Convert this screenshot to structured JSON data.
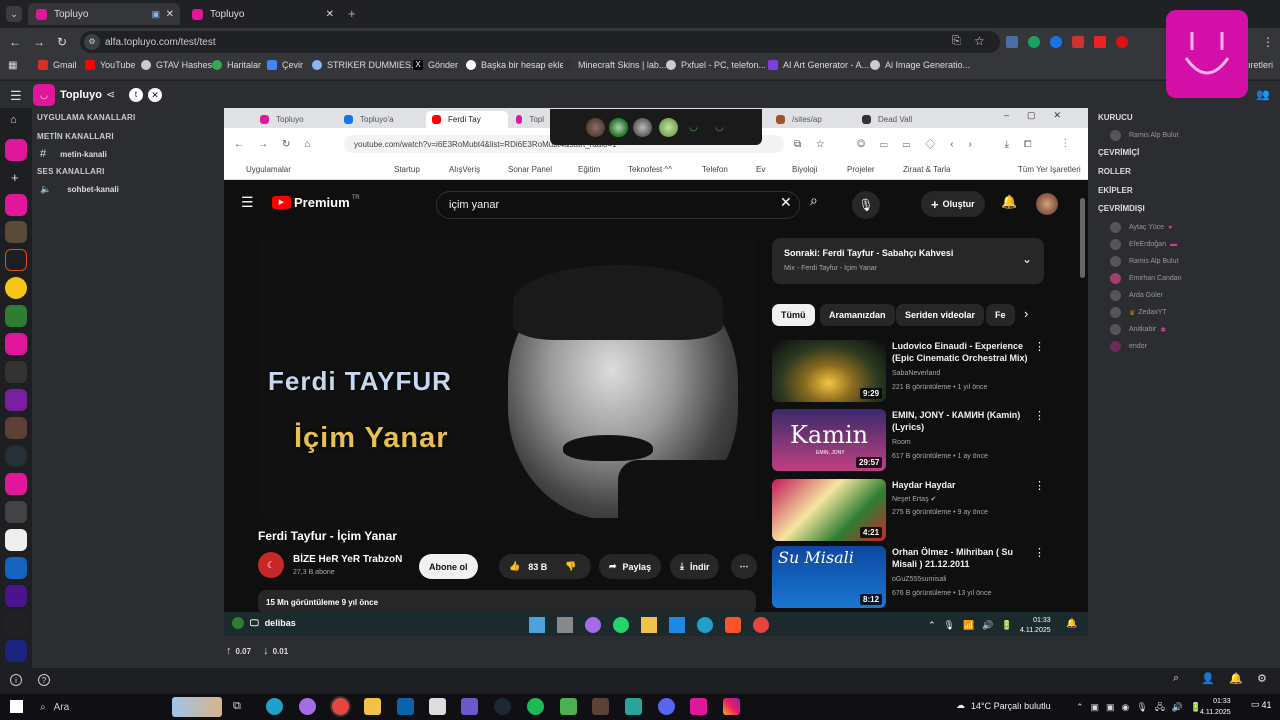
{
  "browser": {
    "tabs": [
      {
        "label": "Topluyo"
      },
      {
        "label": "Topluyo"
      }
    ],
    "url": "alfa.topluyo.com/test/test",
    "bookmarks": [
      "Gmail",
      "YouTube",
      "GTAV Hashes",
      "Haritalar",
      "Çevir",
      "STRIKER DUMMIES...",
      "Gönder",
      "Başka bir hesap ekle",
      "Minecraft Skins | lab...",
      "Pxfuel - PC, telefon...",
      "AI Art Generator - A...",
      "Ai Image Generatio..."
    ],
    "bookmarks_overflow": "ıretleri"
  },
  "app": {
    "name": "Topluyo",
    "sections": {
      "app_channels": "UYGULAMA KANALLARI",
      "text_channels": "METİN KANALLARI",
      "voice_channels": "SES KANALLARI"
    },
    "text_channel": "metin-kanali",
    "voice_channel": "sohbet-kanali",
    "stats": {
      "up": "0.07",
      "down": "0.01"
    }
  },
  "members": {
    "kurucu_title": "KURUCU",
    "kurucu": [
      "Ramis Alp Bulut"
    ],
    "online_title": "ÇEVRİMİÇİ",
    "roles_title": "ROLLER",
    "teams_title": "EKİPLER",
    "offline_title": "ÇEVRİMDIŞI",
    "offline": [
      "Aytaç Yüce",
      "EfeErdoğan",
      "Ramis Alp Bulut",
      "Emirhan Candan",
      "Arda Güler",
      "ZedaxYT",
      "Anitkabir",
      "endor"
    ]
  },
  "stream": {
    "tabs": [
      "Topluyo",
      "Topluyo'a",
      "Ferdi Tay",
      "Topl",
      "/sites/ap",
      "Dead Vall"
    ],
    "url": "youtube.com/watch?v=i6E3RoMubt4&list=RDi6E3RoMubt4&start_radio=1",
    "bookmarks": [
      "Uygulamalar",
      "Startup",
      "AlışVeriş",
      "Sonar Panel",
      "Eğitim",
      "Teknofest ^^",
      "Telefon",
      "Ev",
      "Biyoloji",
      "Projeler",
      "Ziraat & Tarla",
      "Tüm Yer İşaretleri"
    ],
    "yt_logo": "Premium",
    "yt_region": "TR",
    "search_value": "içim yanar",
    "create_label": "Oluştur",
    "video_text_1": "Ferdi TAYFUR",
    "video_text_2": "İçim Yanar",
    "video_title": "Ferdi Tayfur - İçim Yanar",
    "channel_name": "BİZE HeR YeR TrabzoN",
    "subs": "27,3 B abone",
    "subscribe_label": "Abone ol",
    "likes": "83 B",
    "share_label": "Paylaş",
    "download_label": "İndir",
    "views": "15 Mn görüntüleme  9 yıl önce",
    "next_title": "Sonraki: Ferdi Tayfur - Sabahçı Kahvesi",
    "next_sub": "Mix - Ferdi Tayfur - İçim Yanar",
    "chips": [
      "Tümü",
      "Aramanızdan",
      "Seriden videolar",
      "Fe"
    ],
    "recommendations": [
      {
        "title": "Ludovico Einaudi - Experience (Epic Cinematic Orchestral Mix)",
        "channel": "SabaNeverland",
        "meta": "221 B görüntüleme • 1 yıl önce",
        "duration": "9:29"
      },
      {
        "title": "EMIN, JONY - КАМИН (Kamin) (Lyrics)",
        "channel": "Room",
        "meta": "617 B görüntüleme • 1 ay önce",
        "duration": "29:57",
        "thumb_text": "Kamin",
        "thumb_sub": "EMIN, JONY"
      },
      {
        "title": "Haydar Haydar",
        "channel": "Neşet Ertaş",
        "meta": "275 B görüntüleme • 9 ay önce",
        "duration": "4:21"
      },
      {
        "title": "Orhan Ölmez - Mihriban ( Su Misali ) 21.12.2011",
        "channel": "oGuZ555sumisali",
        "meta": "676 B görüntüleme • 13 yıl önce",
        "duration": "8:12",
        "thumb_text": "Su Misali"
      }
    ],
    "taskbar_user": "delibas",
    "time": "01:33",
    "date": "4.11.2025"
  },
  "taskbar": {
    "search": "Ara",
    "weather": "14°C  Parçalı bulutlu",
    "time": "01:33",
    "date": "4.11.2025",
    "notif": "41"
  }
}
